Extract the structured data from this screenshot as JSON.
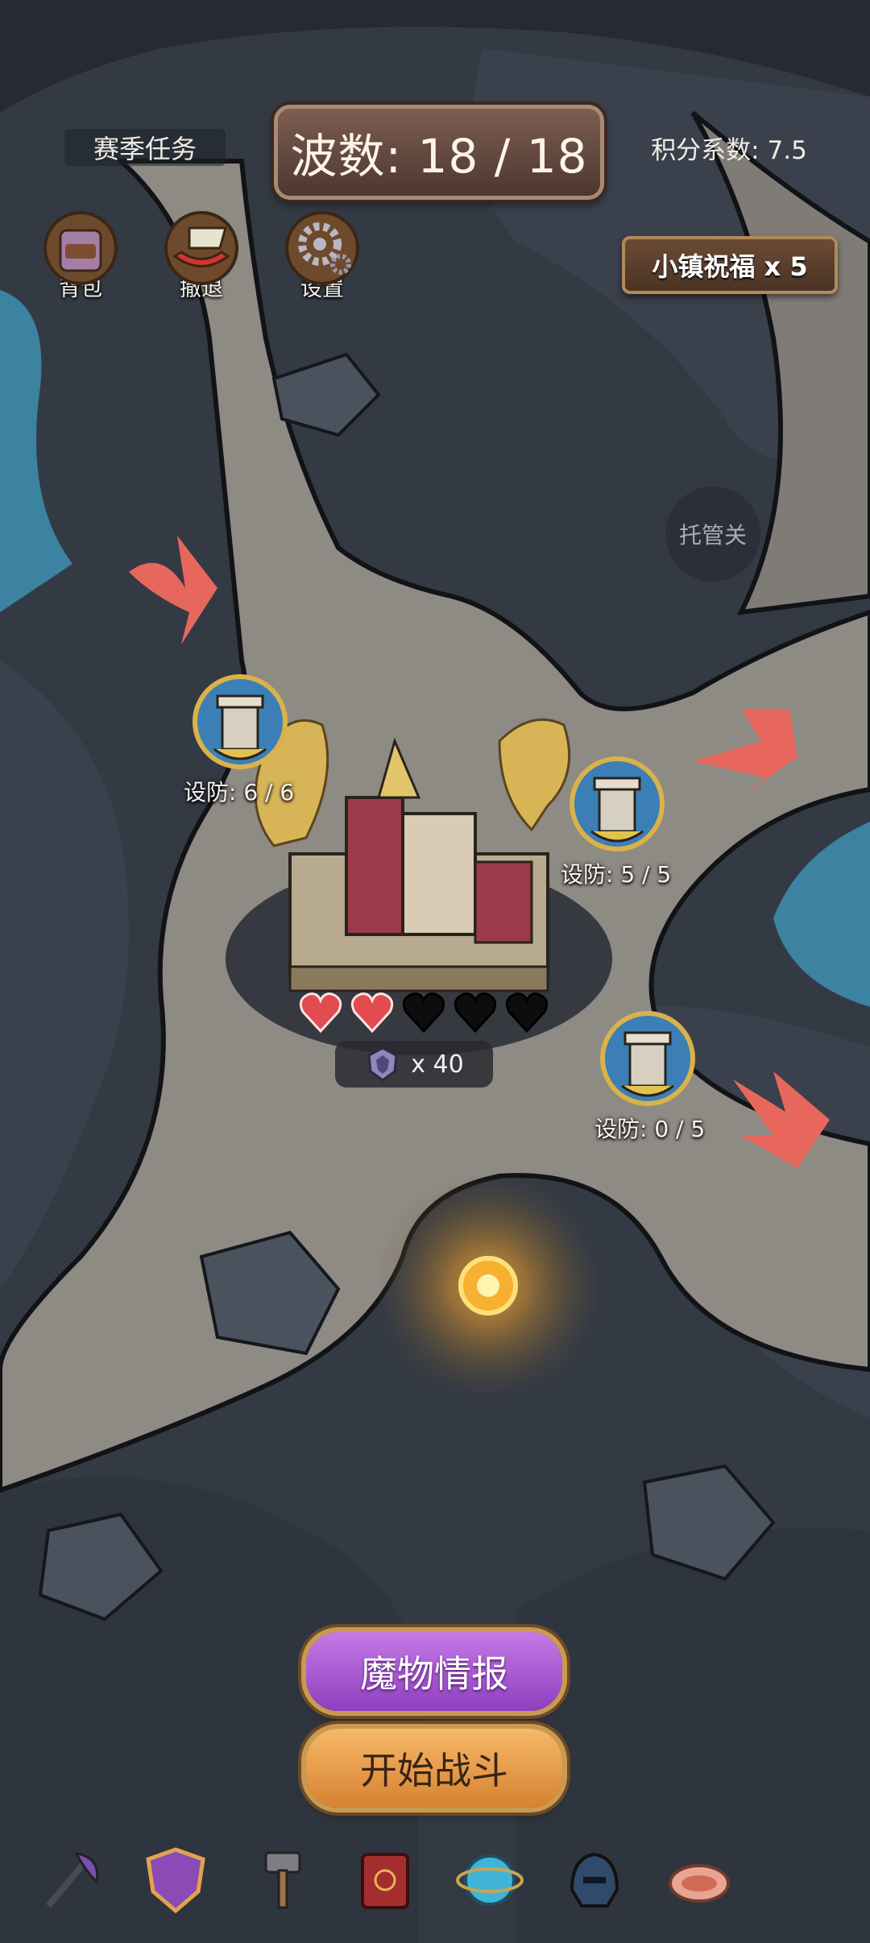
{
  "header": {
    "season_task": "赛季任务",
    "wave": "波数: 18 / 18",
    "score_factor": "积分系数: 7.5"
  },
  "top_buttons": {
    "bag": "背包",
    "retreat": "撤退",
    "settings": "设置"
  },
  "blessing": "小镇祝福 x 5",
  "auto_toggle": "托管关",
  "towers": [
    {
      "label": "设防: 6 / 6"
    },
    {
      "label": "设防: 5 / 5"
    },
    {
      "label": "设防: 0 / 5"
    }
  ],
  "base": {
    "lives_filled": 2,
    "lives_total": 5,
    "reward": "x 40"
  },
  "actions": {
    "monster_info": "魔物情报",
    "start_battle": "开始战斗"
  },
  "hotbar": [
    "axe-icon",
    "shield-icon",
    "hammer-icon",
    "spellbook-icon",
    "orb-icon",
    "helmet-icon",
    "meat-icon"
  ],
  "colors": {
    "heart_filled": "#e24b4f",
    "heart_empty": "#0d0d0d",
    "arrow": "#e8675c",
    "water": "#3e8fb2",
    "path": "#8e8a84"
  }
}
